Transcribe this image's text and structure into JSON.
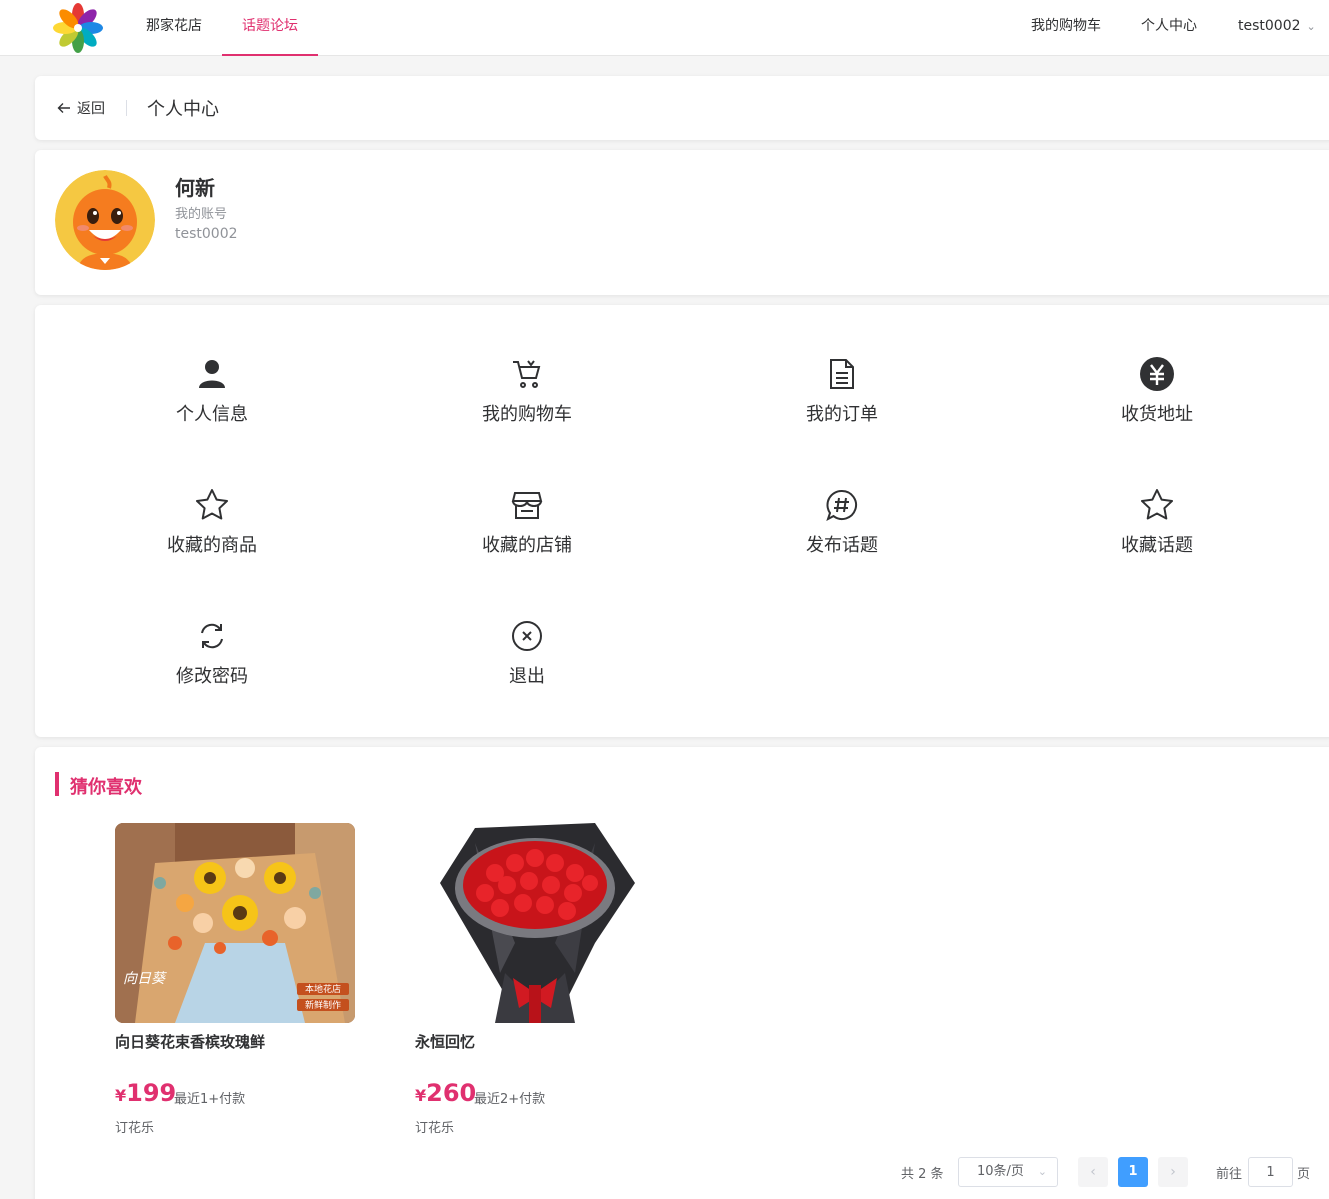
{
  "header": {
    "nav": [
      "那家花店",
      "话题论坛"
    ],
    "active_nav": "话题论坛",
    "right_nav": [
      "我的购物车",
      "个人中心"
    ],
    "username": "test0002"
  },
  "breadcrumb": {
    "back_label": "返回",
    "title": "个人中心"
  },
  "profile": {
    "name": "何新",
    "account_label": "我的账号",
    "account": "test0002"
  },
  "menu": [
    {
      "label": "个人信息",
      "icon": "user-icon"
    },
    {
      "label": "我的购物车",
      "icon": "cart-icon"
    },
    {
      "label": "我的订单",
      "icon": "document-icon"
    },
    {
      "label": "收货地址",
      "icon": "yen-circle-icon"
    },
    {
      "label": "收藏的商品",
      "icon": "star-icon"
    },
    {
      "label": "收藏的店铺",
      "icon": "shop-icon"
    },
    {
      "label": "发布话题",
      "icon": "hashtag-icon"
    },
    {
      "label": "收藏话题",
      "icon": "star-icon"
    },
    {
      "label": "修改密码",
      "icon": "refresh-icon"
    },
    {
      "label": "退出",
      "icon": "close-circle-icon"
    }
  ],
  "recommend": {
    "title": "猜你喜欢",
    "products": [
      {
        "name": "向日葵花束香槟玫瑰鲜",
        "price_symbol": "¥",
        "price": "199",
        "sold": "最近1+付款",
        "shop": "订花乐",
        "image_text": [
          "向日葵",
          "本地花店",
          "新鲜制作"
        ]
      },
      {
        "name": "永恒回忆",
        "price_symbol": "¥",
        "price": "260",
        "sold": "最近2+付款",
        "shop": "订花乐"
      }
    ]
  },
  "pagination": {
    "total": "共 2 条",
    "page_size": "10条/页",
    "current": "1",
    "goto_label": "前往",
    "goto_value": "1",
    "page_label": "页"
  },
  "colors": {
    "accent": "#e0306f",
    "primary": "#409eff"
  }
}
